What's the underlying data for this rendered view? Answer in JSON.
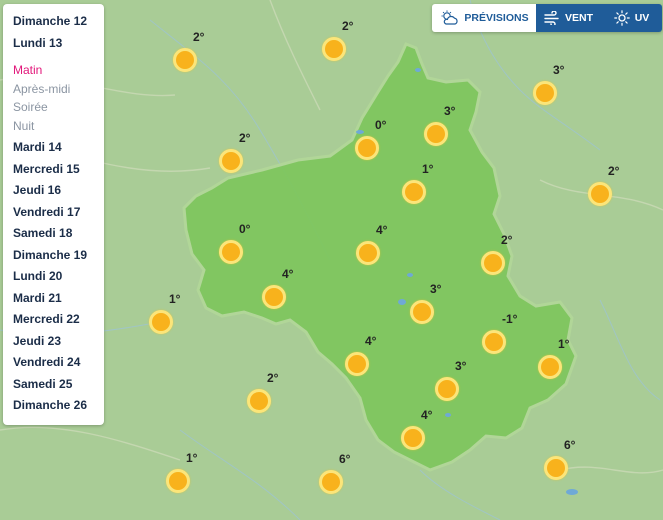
{
  "days": [
    {
      "label": "Dimanche 12"
    },
    {
      "label": "Lundi 13"
    },
    {
      "label": "Mardi 14"
    },
    {
      "label": "Mercredi 15"
    },
    {
      "label": "Jeudi 16"
    },
    {
      "label": "Vendredi 17"
    },
    {
      "label": "Samedi 18"
    },
    {
      "label": "Dimanche 19"
    },
    {
      "label": "Lundi 20"
    },
    {
      "label": "Mardi 21"
    },
    {
      "label": "Mercredi 22"
    },
    {
      "label": "Jeudi 23"
    },
    {
      "label": "Vendredi 24"
    },
    {
      "label": "Samedi 25"
    },
    {
      "label": "Dimanche 26"
    }
  ],
  "periods": [
    {
      "label": "Matin",
      "active": true
    },
    {
      "label": "Après-midi",
      "active": false
    },
    {
      "label": "Soirée",
      "active": false
    },
    {
      "label": "Nuit",
      "active": false
    }
  ],
  "tabs": {
    "previsions": "PRÉVISIONS",
    "vent": "VENT",
    "uv": "UV"
  },
  "colors": {
    "accent": "#1f5c99",
    "active_period": "#e2177a",
    "department_fill": "#7fc65f",
    "background": "#a9cc96",
    "sun": "#f8b21c"
  },
  "cities": [
    {
      "temp": "2°"
    },
    {
      "temp": "2°"
    },
    {
      "temp": "3°"
    },
    {
      "temp": "0°"
    },
    {
      "temp": "3°"
    },
    {
      "temp": "2°"
    },
    {
      "temp": "1°"
    },
    {
      "temp": "2°"
    },
    {
      "temp": "0°"
    },
    {
      "temp": "4°"
    },
    {
      "temp": "2°"
    },
    {
      "temp": "4°"
    },
    {
      "temp": "3°"
    },
    {
      "temp": "1°"
    },
    {
      "temp": "-1°"
    },
    {
      "temp": "4°"
    },
    {
      "temp": "1°"
    },
    {
      "temp": "3°"
    },
    {
      "temp": "2°"
    },
    {
      "temp": "4°"
    },
    {
      "temp": "6°"
    },
    {
      "temp": "1°"
    },
    {
      "temp": "6°"
    }
  ]
}
